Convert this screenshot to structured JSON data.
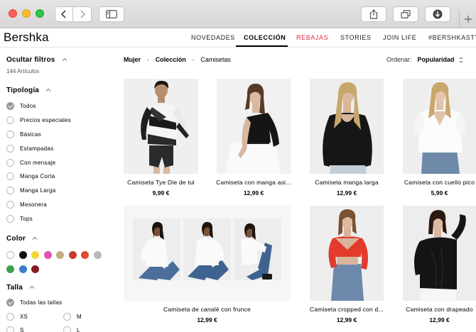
{
  "site": {
    "logo": "Bershka",
    "nav": [
      {
        "label": "NOVEDADES"
      },
      {
        "label": "COLECCIÓN"
      },
      {
        "label": "REBAJAS"
      },
      {
        "label": "STORIES"
      },
      {
        "label": "JOIN LIFE"
      },
      {
        "label": "#BERSHKASTYLE"
      }
    ]
  },
  "filters": {
    "hide_label": "Ocultar filtros",
    "article_count": "144 Artículos",
    "type_title": "Tipología",
    "types": [
      {
        "label": "Todos",
        "checked": true
      },
      {
        "label": "Precios especiales",
        "checked": false
      },
      {
        "label": "Básicas",
        "checked": false
      },
      {
        "label": "Estampadas",
        "checked": false
      },
      {
        "label": "Con mensaje",
        "checked": false
      },
      {
        "label": "Manga Corta",
        "checked": false
      },
      {
        "label": "Manga Larga",
        "checked": false
      },
      {
        "label": "Mesonera",
        "checked": false
      },
      {
        "label": "Tops",
        "checked": false
      }
    ],
    "color_title": "Color",
    "colors": [
      "#ffffff",
      "#111111",
      "#f1d838",
      "#e04fb6",
      "#bfae80",
      "#c8392c",
      "#e04a2f",
      "#b7b7b7",
      "#3aa24a",
      "#3c7ec9",
      "#8a1c22"
    ],
    "size_title": "Talla",
    "all_sizes_label": "Todas las tallas",
    "sizes": [
      "XS",
      "M",
      "S",
      "L"
    ]
  },
  "breadcrumb": {
    "items": [
      "Mujer",
      "Colección",
      "Camisetas"
    ]
  },
  "sort": {
    "label": "Ordenar:",
    "value": "Popularidad"
  },
  "products": [
    {
      "name": "Camiseta Tye Die de tul",
      "price": "9,99 €"
    },
    {
      "name": "Camiseta con manga asi...",
      "price": "12,99 €"
    },
    {
      "name": "Camiseta manga larga",
      "price": "12,99 €"
    },
    {
      "name": "Camiseta con cuello pico",
      "price": "5,99 €"
    },
    {
      "name": "Camiseta de canalé con frunce",
      "price": "12,99 €"
    },
    {
      "name": "Camiseta cropped con d...",
      "price": "12,99 €"
    },
    {
      "name": "Camiseta con drapeado",
      "price": "12,99 €"
    }
  ]
}
